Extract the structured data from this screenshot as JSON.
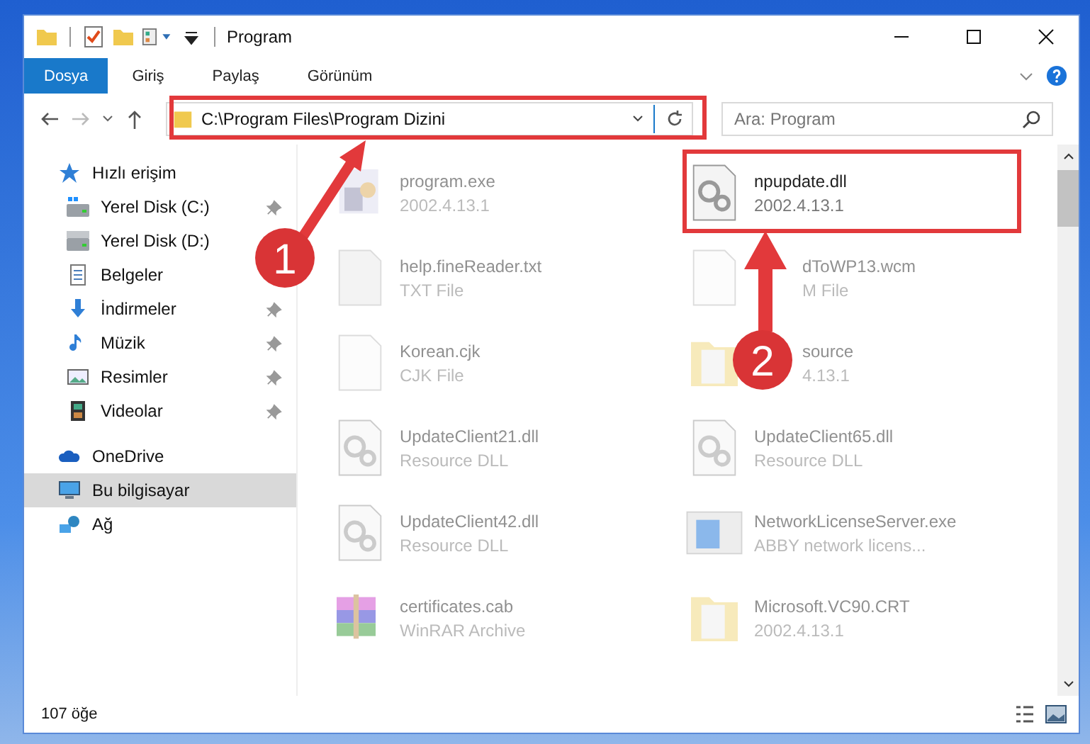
{
  "window": {
    "title": "Program"
  },
  "ribbon_tabs": [
    {
      "label": "Dosya",
      "selected": true
    },
    {
      "label": "Giriş",
      "selected": false
    },
    {
      "label": "Paylaş",
      "selected": false
    },
    {
      "label": "Görünüm",
      "selected": false
    }
  ],
  "address_bar": {
    "path": "C:\\Program Files\\Program Dizini"
  },
  "search": {
    "placeholder": "Ara: Program"
  },
  "sidebar": {
    "items": [
      {
        "label": "Hızlı erişim",
        "kind": "star",
        "selected": false,
        "children": [
          {
            "label": "Yerel Disk (C:)",
            "kind": "drive-win",
            "pinned": true,
            "selected": false
          },
          {
            "label": "Yerel Disk (D:)",
            "kind": "drive",
            "pinned": false,
            "selected": false
          },
          {
            "label": "Belgeler",
            "kind": "docs",
            "pinned": false,
            "selected": false
          },
          {
            "label": "İndirmeler",
            "kind": "download",
            "pinned": true,
            "selected": false
          },
          {
            "label": "Müzik",
            "kind": "music",
            "pinned": true,
            "selected": false
          },
          {
            "label": "Resimler",
            "kind": "pictures",
            "pinned": true,
            "selected": false
          },
          {
            "label": "Videolar",
            "kind": "videos",
            "pinned": true,
            "selected": false
          }
        ]
      },
      {
        "label": "OneDrive",
        "kind": "cloud",
        "selected": false
      },
      {
        "label": "Bu bilgisayar",
        "kind": "pc",
        "selected": true
      },
      {
        "label": "Ağ",
        "kind": "network",
        "selected": false
      }
    ]
  },
  "files": [
    {
      "name": "program.exe",
      "detail": "2002.4.13.1",
      "kind": "app",
      "blurred": true,
      "partly_covered": false
    },
    {
      "name": "npupdate.dll",
      "detail": "2002.4.13.1",
      "kind": "dll",
      "blurred": false,
      "partly_covered": false
    },
    {
      "name": "help.fineReader.txt",
      "detail": "TXT File",
      "kind": "text",
      "blurred": true,
      "partly_covered": false
    },
    {
      "name": "dToWP13.wcm",
      "detail": "M File",
      "kind": "blank",
      "blurred": true,
      "partly_covered": true
    },
    {
      "name": "Korean.cjk",
      "detail": "CJK File",
      "kind": "blank",
      "blurred": true,
      "partly_covered": false
    },
    {
      "name": "source",
      "detail": "4.13.1",
      "kind": "folder",
      "blurred": true,
      "partly_covered": true
    },
    {
      "name": "UpdateClient21.dll",
      "detail": "Resource DLL",
      "kind": "dll",
      "blurred": true,
      "partly_covered": false
    },
    {
      "name": "UpdateClient65.dll",
      "detail": "Resource DLL",
      "kind": "dll",
      "blurred": true,
      "partly_covered": false
    },
    {
      "name": "UpdateClient42.dll",
      "detail": "Resource DLL",
      "kind": "dll",
      "blurred": true,
      "partly_covered": false
    },
    {
      "name": "NetworkLicenseServer.exe",
      "detail": "ABBY network licens...",
      "kind": "window",
      "blurred": true,
      "partly_covered": false
    },
    {
      "name": "certificates.cab",
      "detail": "WinRAR Archive",
      "kind": "archive",
      "blurred": true,
      "partly_covered": false
    },
    {
      "name": "Microsoft.VC90.CRT",
      "detail": "2002.4.13.1",
      "kind": "folder",
      "blurred": true,
      "partly_covered": false
    }
  ],
  "status_bar": {
    "count": "107 öğe"
  },
  "annotations": [
    {
      "label": "1"
    },
    {
      "label": "2"
    }
  ]
}
